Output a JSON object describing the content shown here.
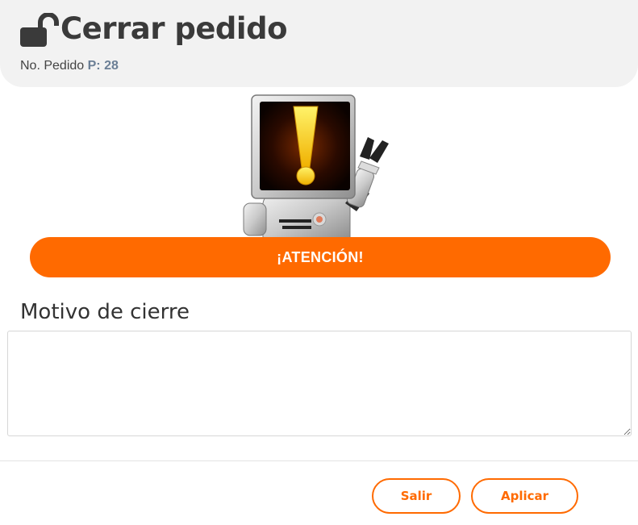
{
  "header": {
    "title": "Cerrar pedido",
    "order_label": "No. Pedido",
    "order_value": "P: 28",
    "icon": "unlocked-padlock-icon"
  },
  "illustration": {
    "icon": "warning-robot-illustration"
  },
  "alert": {
    "text": "¡ATENCIÓN!",
    "color": "#ff6a00"
  },
  "form": {
    "reason_label": "Motivo de cierre",
    "reason_value": ""
  },
  "actions": {
    "exit_label": "Salir",
    "apply_label": "Aplicar"
  },
  "colors": {
    "accent": "#ff6a00",
    "header_bg": "#f2f2f2",
    "order_value": "#6b7f96"
  }
}
